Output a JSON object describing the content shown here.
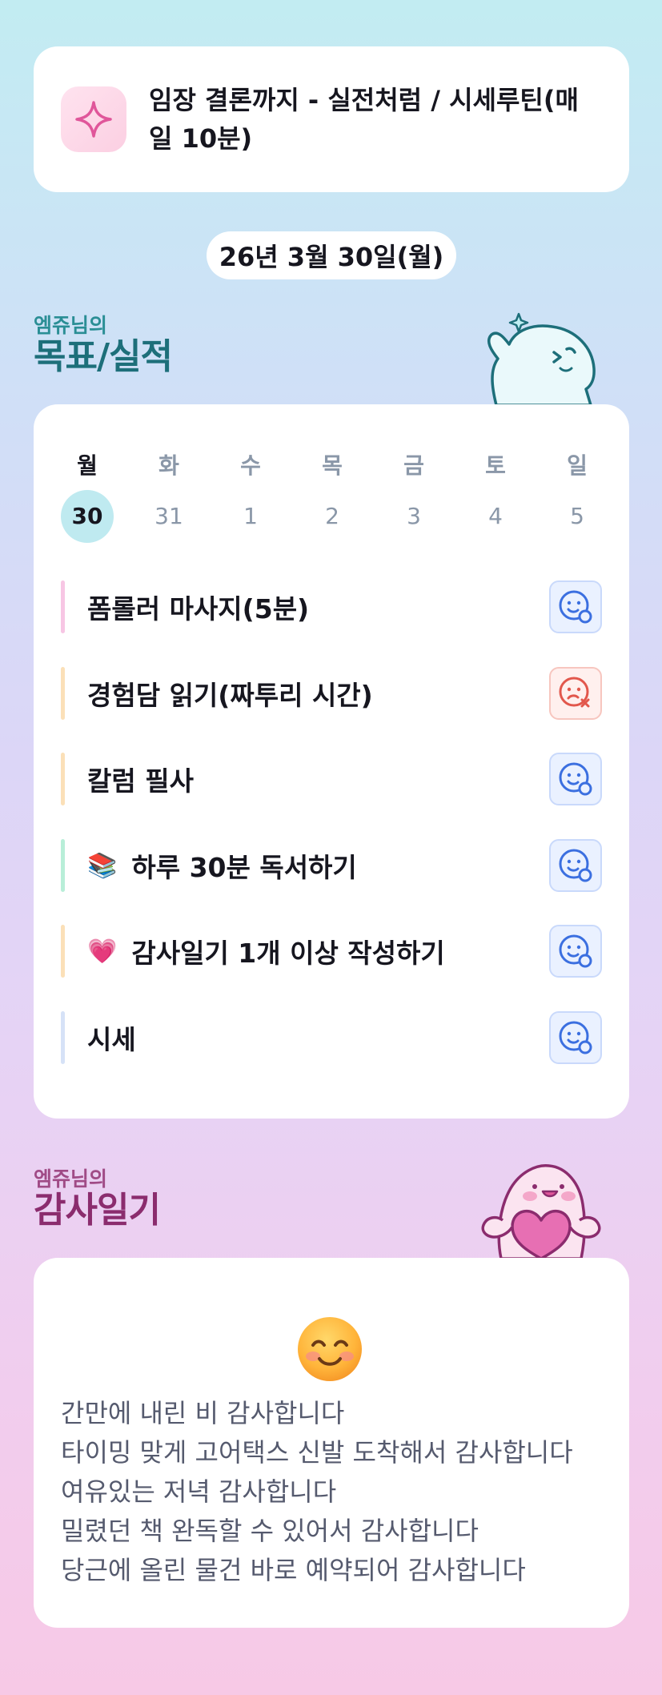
{
  "goal": {
    "title": "임장 결론까지 - 실전처럼 / 시세루틴(매일 10분)",
    "icon": "sparkle-icon"
  },
  "date": "26년 3월 30일(월)",
  "goals_section": {
    "subtitle": "엠쥬님의",
    "title": "목표/실적",
    "mascot": "waving-mascot"
  },
  "week": [
    {
      "name": "월",
      "num": "30",
      "active": true
    },
    {
      "name": "화",
      "num": "31"
    },
    {
      "name": "수",
      "num": "1"
    },
    {
      "name": "목",
      "num": "2"
    },
    {
      "name": "금",
      "num": "3"
    },
    {
      "name": "토",
      "num": "4"
    },
    {
      "name": "일",
      "num": "5"
    }
  ],
  "tasks": [
    {
      "label": "폼롤러 마사지(5분)",
      "color": "#f7c6e4",
      "status": "done",
      "icon": "smile-check-icon"
    },
    {
      "label": "경험담 읽기(짜투리 시간)",
      "color": "#fbe0b8",
      "status": "missed",
      "icon": "sad-x-icon"
    },
    {
      "label": "칼럼 필사",
      "color": "#fbe0b8",
      "status": "done",
      "icon": "smile-check-icon"
    },
    {
      "label": "하루 30분 독서하기",
      "emoji": "📚",
      "color": "#b8eed8",
      "status": "done",
      "icon": "smile-check-icon"
    },
    {
      "label": "감사일기 1개 이상 작성하기",
      "emoji": "💗",
      "color": "#fbe0b8",
      "status": "done",
      "icon": "smile-check-icon"
    },
    {
      "label": "시세",
      "color": "#d6e2f7",
      "status": "done",
      "icon": "smile-check-icon"
    }
  ],
  "gratitude_section": {
    "subtitle": "엠쥬님의",
    "title": "감사일기",
    "mascot": "heart-mascot"
  },
  "gratitude": {
    "emoji": "smiling-face-icon",
    "lines": [
      "간만에 내린 비 감사합니다",
      "타이밍 맞게 고어택스 신발 도착해서 감사합니다",
      "여유있는 저녁 감사합니다",
      "밀렸던 책 완독할 수 있어서 감사합니다",
      "당근에 올린 물건 바로 예약되어 감사합니다"
    ]
  },
  "colors": {
    "ok": "#3b6fe0",
    "fail": "#e2574c",
    "active_day": "#bfeaf0"
  }
}
